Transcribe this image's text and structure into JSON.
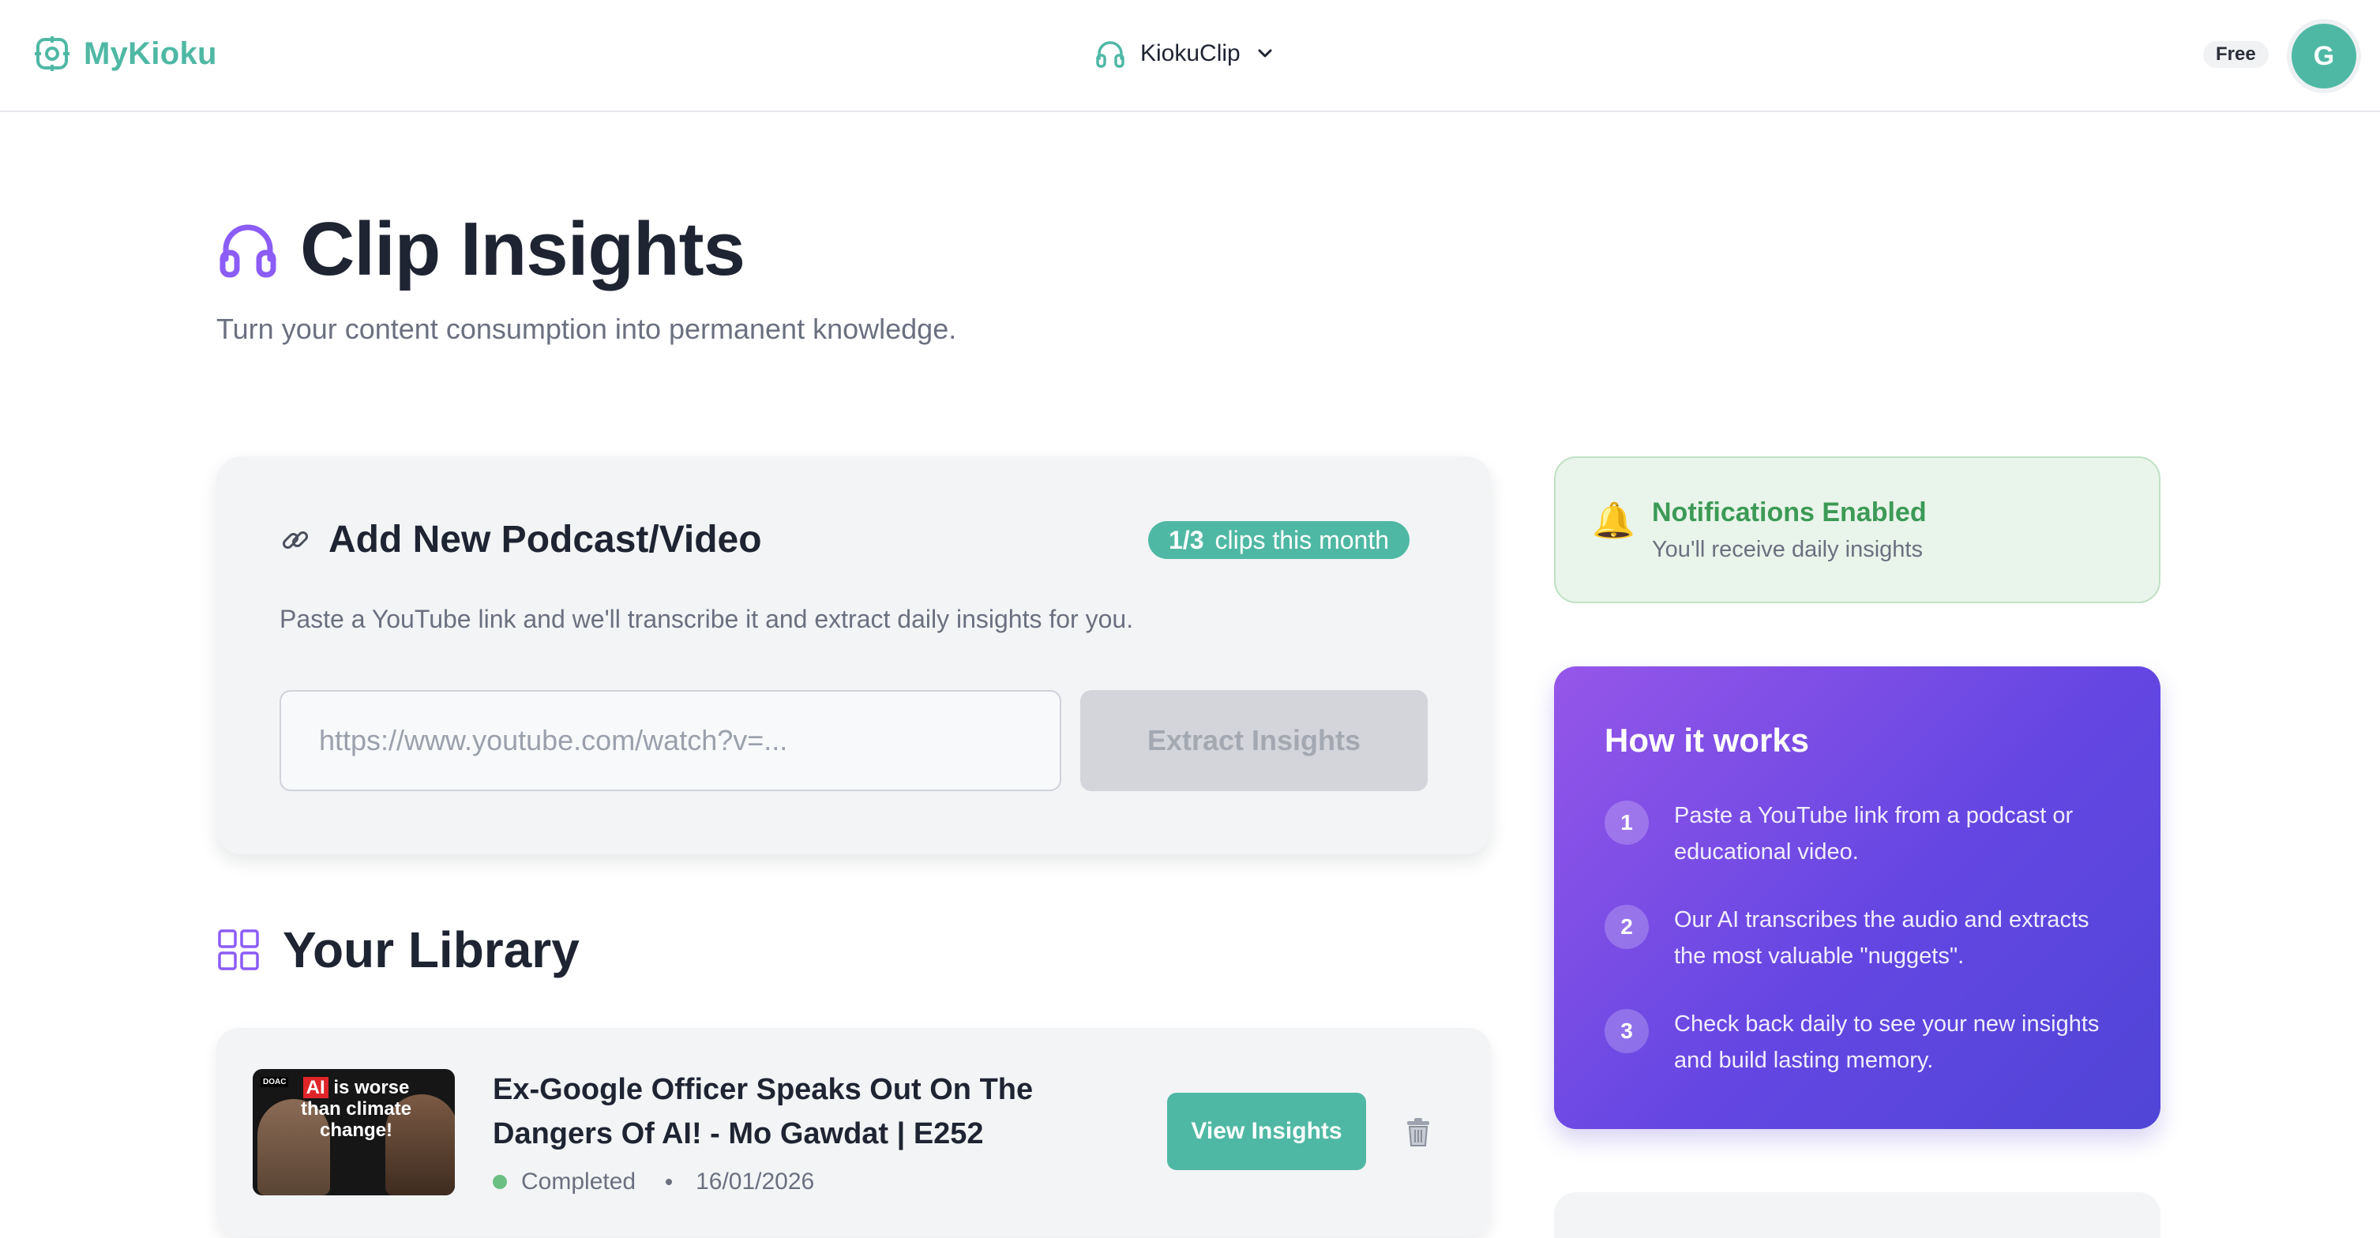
{
  "header": {
    "brand": "MyKioku",
    "app_switcher": "KiokuClip",
    "plan": "Free",
    "avatar_initial": "G"
  },
  "page": {
    "title": "Clip Insights",
    "subtitle": "Turn your content consumption into permanent knowledge."
  },
  "add_card": {
    "title": "Add New Podcast/Video",
    "usage_count": "1/3",
    "usage_label": "clips this month",
    "description": "Paste a YouTube link and we'll transcribe it and extract daily insights for you.",
    "input_placeholder": "https://www.youtube.com/watch?v=...",
    "input_value": "",
    "button_label": "Extract Insights"
  },
  "library": {
    "title": "Your Library",
    "items": [
      {
        "title": "Ex-Google Officer Speaks Out On The Dangers Of AI! - Mo Gawdat | E252",
        "status": "Completed",
        "date": "16/01/2026",
        "thumbnail": {
          "tag": "DOAC",
          "ai_word": "AI",
          "rest": "is worse than climate change!"
        },
        "view_label": "View Insights"
      }
    ]
  },
  "notifications": {
    "title": "Notifications Enabled",
    "subtitle": "You'll receive daily insights"
  },
  "how_it_works": {
    "title": "How it works",
    "steps": [
      {
        "num": "1",
        "text": "Paste a YouTube link from a podcast or educational video."
      },
      {
        "num": "2",
        "text": "Our AI transcribes the audio and extracts the most valuable \"nuggets\"."
      },
      {
        "num": "3",
        "text": "Check back daily to see your new insights and build lasting memory."
      }
    ]
  },
  "colors": {
    "accent": "#4fb8a4",
    "purple": "#8b5cf6",
    "success": "#3c9a56",
    "text": "#1f2433",
    "muted": "#6b7080"
  },
  "icons": {
    "brand": "brain-chip-icon",
    "app_switcher": "headphones-icon",
    "title": "headphones-icon",
    "add_card": "link-icon",
    "library": "grid-icon",
    "notifications": "bell-icon",
    "delete": "trash-icon"
  }
}
